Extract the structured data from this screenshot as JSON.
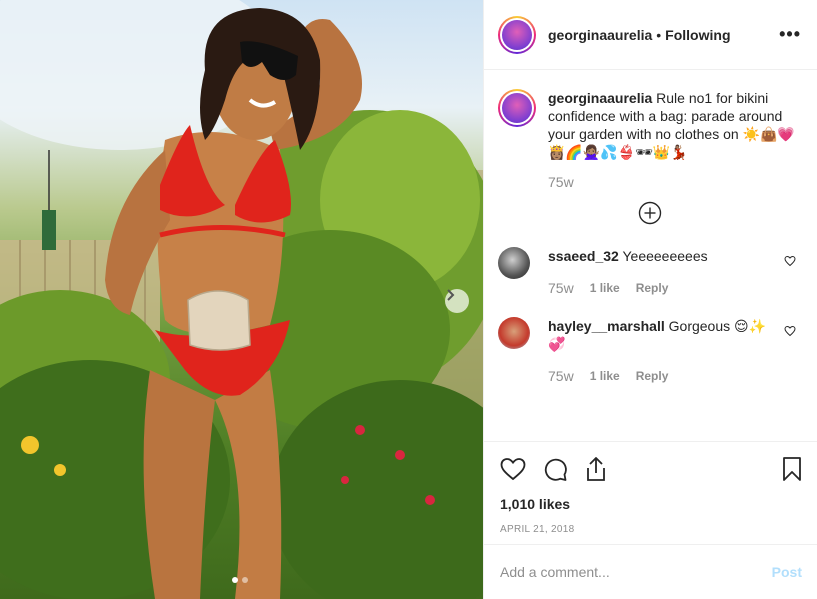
{
  "post": {
    "username": "georginaaurelia",
    "separator": "•",
    "follow_state": "Following",
    "more_icon": "more-options-icon",
    "caption_username": "georginaaurelia",
    "caption_text": "Rule no1 for bikini confidence with a bag: parade around your garden with no clothes on ☀️👜💗👸🏽🌈🙅🏽‍♀️💦👙🕶👑💃🏽",
    "caption_age": "75w",
    "carousel_dots": 2,
    "carousel_active": 1
  },
  "comments": [
    {
      "username": "ssaeed_32",
      "text": "Yeeeeeeeees",
      "age": "75w",
      "likes": "1 like",
      "reply": "Reply"
    },
    {
      "username": "hayley__marshall",
      "text": "Gorgeous 😌✨💞",
      "age": "75w",
      "likes": "1 like",
      "reply": "Reply"
    }
  ],
  "actions": {
    "likes_count": "1,010 likes",
    "date": "APRIL 21, 2018"
  },
  "composer": {
    "placeholder": "Add a comment...",
    "post_label": "Post"
  },
  "colors": {
    "accent_link": "#0095f6",
    "post_disabled": "#b2dffc",
    "muted_text": "#8e8e8e",
    "bikini_red": "#e0241c"
  }
}
